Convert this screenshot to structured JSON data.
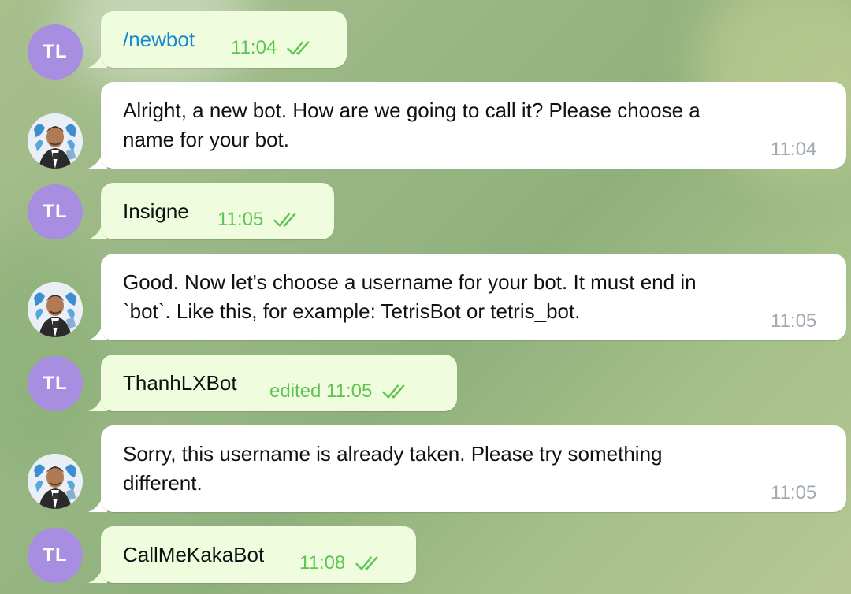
{
  "colors": {
    "outgoing_bubble": "#effdde",
    "incoming_bubble": "#ffffff",
    "outgoing_meta": "#5dc452",
    "incoming_meta": "#a1aab3",
    "user_avatar": "#a88ee0",
    "link": "#168acd"
  },
  "messages": [
    {
      "direction": "out",
      "avatar": "TL",
      "text": "/newbot",
      "time": "11:04",
      "status_icon": "double-check-icon"
    },
    {
      "direction": "in",
      "avatar_icon": "bot-avatar-icon",
      "line1": "Alright, a new bot. How are we going to call it? Please choose a",
      "line2": "name for your bot.",
      "time": "11:04"
    },
    {
      "direction": "out",
      "avatar": "TL",
      "text": "Insigne",
      "time": "11:05",
      "status_icon": "double-check-icon"
    },
    {
      "direction": "in",
      "avatar_icon": "bot-avatar-icon",
      "line1": "Good. Now let's choose a username for your bot. It must end in",
      "line2": "`bot`. Like this, for example: TetrisBot or tetris_bot.",
      "time": "11:05"
    },
    {
      "direction": "out",
      "avatar": "TL",
      "text": "ThanhLXBot",
      "time": "edited 11:05",
      "status_icon": "double-check-icon"
    },
    {
      "direction": "in",
      "avatar_icon": "bot-avatar-icon",
      "line1": "Sorry, this username is already taken. Please try something",
      "line2": "different.",
      "time": "11:05"
    },
    {
      "direction": "out",
      "avatar": "TL",
      "text": "CallMeKakaBot",
      "time": "11:08",
      "status_icon": "double-check-icon"
    }
  ]
}
